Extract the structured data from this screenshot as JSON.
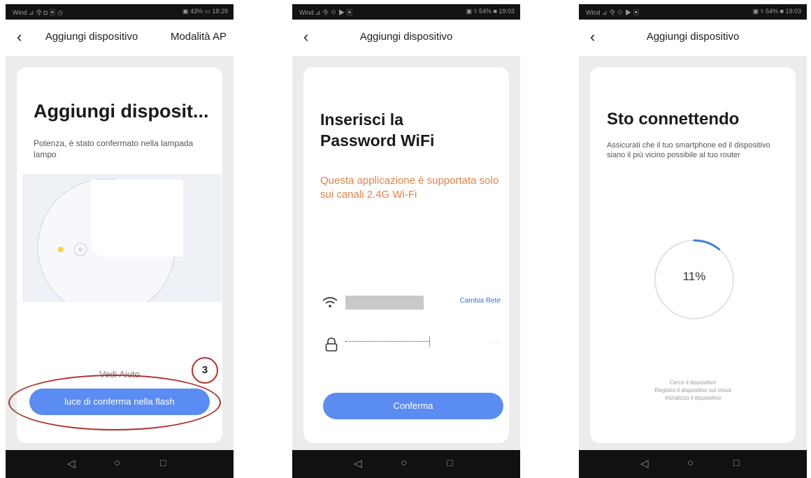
{
  "status_bars": {
    "s1": {
      "left": "Wind ⊿ 令 ◘ ▣ ◷",
      "right": "▣ 43% ▭ 18:29"
    },
    "s2": {
      "left": "Wind ⊿ 令 ☉ ▶ ▣",
      "right": "▣ ⚕ 54% ■ 19:03"
    },
    "s3": {
      "left": "Wind ⊿ 令 ☉ ▶ ▣",
      "right": "▣ ⚕ 54% ■ 19:03"
    }
  },
  "screen1": {
    "title": "Aggiungi dispositivo",
    "right_action": "Modalità AP",
    "heading": "Aggiungi disposit...",
    "description": "Potenza, è stato confermato nella lampada lampo",
    "help_link": "Vedi Aiuto",
    "annotation_number": "3",
    "confirm_button": "luce di conferma nella flash"
  },
  "screen2": {
    "title": "Aggiungi dispositivo",
    "heading_line1": "Inserisci la",
    "heading_line2": "Password WiFi",
    "notice": "Questa applicazione è supportata solo sui canali 2.4G Wi-Fi",
    "change_network": "Cambia Rete",
    "password_toggle": "···",
    "confirm_button": "Conferma"
  },
  "screen3": {
    "title": "Aggiungi dispositivo",
    "heading": "Sto connettendo",
    "description": "Assicurati che il tuo smartphone ed il dispositivo siano il più vicino possibile al tuo router",
    "progress_text": "11%",
    "progress": 0.11,
    "steps": [
      "Cerco il dispositivo",
      "Registro il dispositivo sul cloud",
      "Inizializzo il dispositivo"
    ]
  },
  "nav_icons": [
    "back-triangle-icon",
    "home-circle-icon",
    "recents-square-icon"
  ],
  "colors": {
    "accent_blue": "#5b8cf2",
    "notice_orange": "#e0824a",
    "annotation_red": "#b0302a",
    "progress_blue": "#3f7fd6"
  }
}
